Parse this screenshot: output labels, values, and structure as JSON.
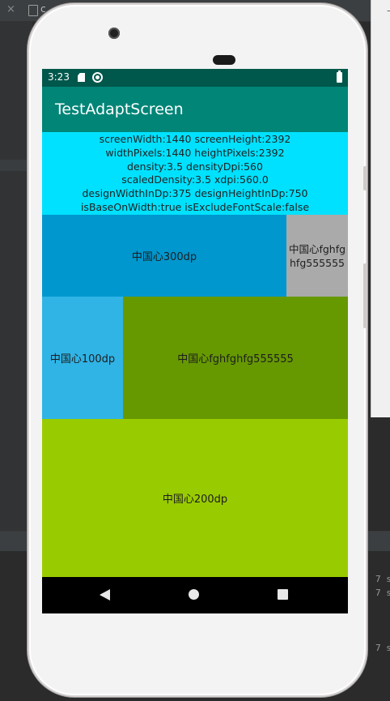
{
  "ide": {
    "tab_close": "×",
    "tab_label": "c",
    "log_lines": [
      "7 s",
      "7 s",
      "7 s"
    ]
  },
  "status_bar": {
    "time": "3:23"
  },
  "app_bar": {
    "title": "TestAdaptScreen"
  },
  "info_panel": {
    "lines": [
      "screenWidth:1440  screenHeight:2392",
      "widthPixels:1440  heightPixels:2392",
      "density:3.5  densityDpi:560",
      "scaledDensity:3.5  xdpi:560.0",
      "designWidthInDp:375  designHeightInDp:750",
      "isBaseOnWidth:true  isExcludeFontScale:false"
    ]
  },
  "blocks": {
    "block_300dp": "中国心300dp",
    "block_gray": "中国心fghfghfg555555",
    "block_100dp": "中国心100dp",
    "block_green": "中国心fghfghfg555555",
    "block_200dp": "中国心200dp"
  },
  "colors": {
    "status_bar": "#00574b",
    "app_bar": "#008577",
    "info_panel": "#00e1ff",
    "block_300dp": "#0097ce",
    "block_gray": "#aaaaaa",
    "block_100dp": "#30b4e6",
    "block_green": "#669900",
    "block_200dp": "#99cc00"
  },
  "icons": {
    "status": [
      "sd-card-icon",
      "sync-icon",
      "battery-icon"
    ],
    "nav": [
      "back-icon",
      "home-icon",
      "recents-icon"
    ]
  }
}
